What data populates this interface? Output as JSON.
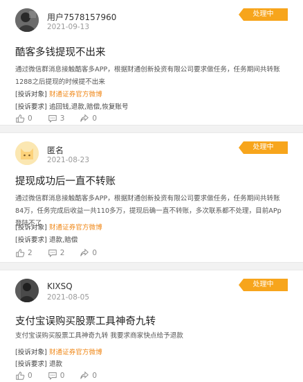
{
  "complaints": [
    {
      "username": "用户7578157960",
      "date": "2021-09-13",
      "status": "处理中",
      "title": "酷客多钱提现不出来",
      "description": "通过微信群消息接触酷客多APP，根据财通创新投资有限公司要求做任务，任务期间共转账1288之后提现的时候提不出来",
      "object_label": "[投诉对象]",
      "object_value": "财通证券官方微博",
      "request_label": "[投诉要求]",
      "request_value": "追回钱,退款,赔偿,恢复账号",
      "likes": "0",
      "comments": "3",
      "shares": "0"
    },
    {
      "username": "匿名",
      "date": "2021-08-23",
      "status": "处理中",
      "title": "提现成功后一直不转账",
      "description": "通过微信群消息接触酷客多APP，根据财通创新投资有限公司要求做任务，任务期间共转账84万，任务完成后收益一共110多万，提现后确一直不转账，多次联系都不处理，目前APp登陆不了",
      "object_label": "[投诉对象]",
      "object_value": "财通证券官方微博",
      "request_label": "[投诉要求]",
      "request_value": "退款,赔偿",
      "likes": "2",
      "comments": "2",
      "shares": "0"
    },
    {
      "username": "KIXSQ",
      "date": "2021-08-05",
      "status": "处理中",
      "title": "支付宝误购买股票工具神奇九转",
      "description": "支付宝误购买股票工具神奇九转 我要求商家快点给予退款",
      "object_label": "[投诉对象]",
      "object_value": "财通证券官方微博",
      "request_label": "[投诉要求]",
      "request_value": "退款",
      "likes": "0",
      "comments": "0",
      "shares": "0"
    }
  ],
  "icons": {
    "like": "thumbs-up-icon",
    "comment": "comment-icon",
    "share": "share-icon"
  },
  "colors": {
    "badge": "#f7a51c",
    "link": "#f08a1c"
  }
}
